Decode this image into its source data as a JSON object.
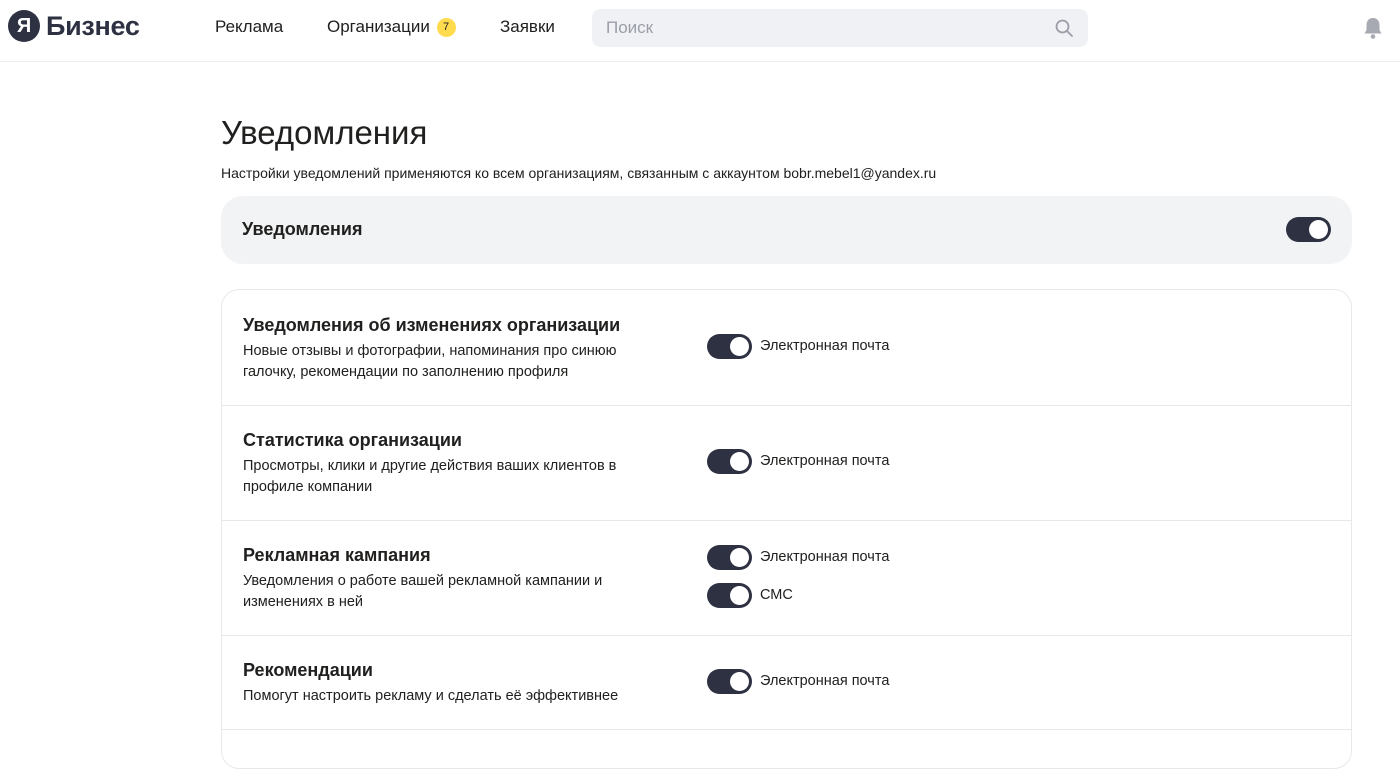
{
  "header": {
    "logo_letter": "Я",
    "logo_text": "Бизнес",
    "nav": [
      {
        "label": "Реклама"
      },
      {
        "label": "Организации",
        "badge": "7"
      },
      {
        "label": "Заявки"
      }
    ],
    "search_placeholder": "Поиск"
  },
  "page": {
    "title": "Уведомления",
    "description": "Настройки уведомлений применяются ко всем организациям, связанным с аккаунтом bobr.mebel1@yandex.ru"
  },
  "master": {
    "label": "Уведомления",
    "enabled": true
  },
  "sections": [
    {
      "title": "Уведомления об изменениях организации",
      "description": "Новые отзывы и фотографии, напоминания про синюю галочку, рекомендации по заполнению профиля",
      "options": [
        {
          "label": "Электронная почта",
          "enabled": true
        }
      ]
    },
    {
      "title": "Статистика организации",
      "description": "Просмотры, клики и другие действия ваших клиентов в профиле компании",
      "options": [
        {
          "label": "Электронная почта",
          "enabled": true
        }
      ]
    },
    {
      "title": "Рекламная кампания",
      "description": "Уведомления о работе вашей рекламной кампании и изменениях в ней",
      "options": [
        {
          "label": "Электронная почта",
          "enabled": true
        },
        {
          "label": "СМС",
          "enabled": true
        }
      ]
    },
    {
      "title": "Рекомендации",
      "description": "Помогут настроить рекламу и сделать её эффективнее",
      "options": [
        {
          "label": "Электронная почта",
          "enabled": true
        }
      ]
    }
  ]
}
